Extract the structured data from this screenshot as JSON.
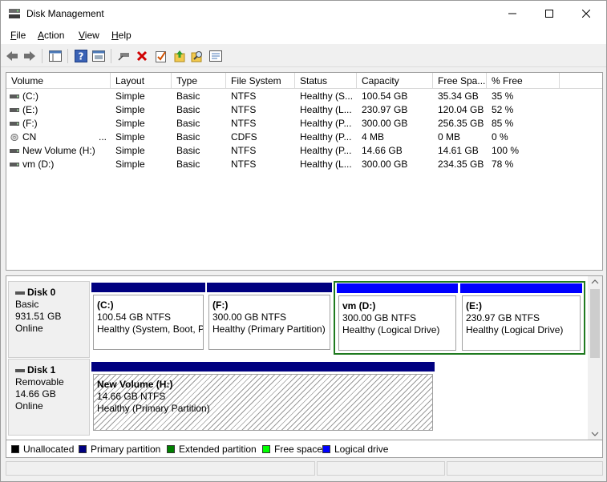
{
  "window": {
    "title": "Disk Management"
  },
  "menu": [
    {
      "label": "File",
      "key": "F",
      "rest": "ile"
    },
    {
      "label": "Action",
      "key": "A",
      "rest": "ction"
    },
    {
      "label": "View",
      "key": "V",
      "rest": "iew"
    },
    {
      "label": "Help",
      "key": "H",
      "rest": "elp"
    }
  ],
  "toolbar": [
    "back-icon",
    "forward-icon",
    "console-tree-icon",
    "help-icon",
    "properties-icon",
    "connect-icon",
    "delete-icon",
    "checklist-icon",
    "export-icon",
    "search-icon",
    "settings-icon"
  ],
  "columns": [
    "Volume",
    "Layout",
    "Type",
    "File System",
    "Status",
    "Capacity",
    "Free Spa...",
    "% Free"
  ],
  "volumes": [
    {
      "name": "(C:)",
      "layout": "Simple",
      "type": "Basic",
      "fs": "NTFS",
      "status": "Healthy (S...",
      "capacity": "100.54 GB",
      "free": "35.34 GB",
      "pct": "35 %",
      "icon": "disk"
    },
    {
      "name": "(E:)",
      "layout": "Simple",
      "type": "Basic",
      "fs": "NTFS",
      "status": "Healthy (L...",
      "capacity": "230.97 GB",
      "free": "120.04 GB",
      "pct": "52 %",
      "icon": "disk"
    },
    {
      "name": "(F:)",
      "layout": "Simple",
      "type": "Basic",
      "fs": "NTFS",
      "status": "Healthy (P...",
      "capacity": "300.00 GB",
      "free": "256.35 GB",
      "pct": "85 %",
      "icon": "disk"
    },
    {
      "name": "CN",
      "name_suffix": "...",
      "layout": "Simple",
      "type": "Basic",
      "fs": "CDFS",
      "status": "Healthy (P...",
      "capacity": "4 MB",
      "free": "0 MB",
      "pct": "0 %",
      "icon": "cd"
    },
    {
      "name": "New Volume (H:)",
      "layout": "Simple",
      "type": "Basic",
      "fs": "NTFS",
      "status": "Healthy (P...",
      "capacity": "14.66 GB",
      "free": "14.61 GB",
      "pct": "100 %",
      "icon": "disk"
    },
    {
      "name": "vm (D:)",
      "layout": "Simple",
      "type": "Basic",
      "fs": "NTFS",
      "status": "Healthy (L...",
      "capacity": "300.00 GB",
      "free": "234.35 GB",
      "pct": "78 %",
      "icon": "disk"
    }
  ],
  "disks": [
    {
      "name": "Disk 0",
      "kind": "Basic",
      "size": "931.51 GB",
      "state": "Online",
      "partitions": [
        {
          "name": "(C:)",
          "line1": "100.54 GB NTFS",
          "line2": "Healthy (System, Boot, P"
        },
        {
          "name": "(F:)",
          "line1": "300.00 GB NTFS",
          "line2": "Healthy (Primary Partition)"
        },
        {
          "name": "vm  (D:)",
          "line1": "300.00 GB NTFS",
          "line2": "Healthy (Logical Drive)"
        },
        {
          "name": "(E:)",
          "line1": "230.97 GB NTFS",
          "line2": "Healthy (Logical Drive)"
        }
      ]
    },
    {
      "name": "Disk 1",
      "kind": "Removable",
      "size": "14.66 GB",
      "state": "Online",
      "partitions": [
        {
          "name": "New Volume  (H:)",
          "line1": "14.66 GB NTFS",
          "line2": "Healthy (Primary Partition)"
        }
      ]
    }
  ],
  "legend": [
    {
      "label": "Unallocated",
      "color": "#000000"
    },
    {
      "label": "Primary partition",
      "color": "#000080"
    },
    {
      "label": "Extended partition",
      "color": "#008000"
    },
    {
      "label": "Free space",
      "color": "#00ff00"
    },
    {
      "label": "Logical drive",
      "color": "#0000ff"
    }
  ],
  "colors": {
    "primary": "#000080",
    "logical": "#0000ff",
    "extended": "#008000",
    "selection": "#1f7a1f"
  }
}
